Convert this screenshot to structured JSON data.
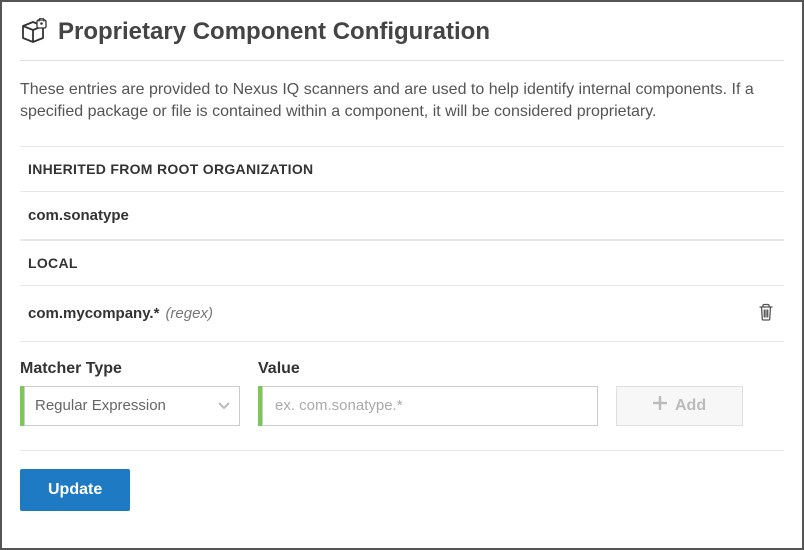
{
  "header": {
    "title": "Proprietary Component Configuration"
  },
  "description": "These entries are provided to Nexus IQ scanners and are used to help identify internal components. If a specified package or file is contained within a component, it will be considered proprietary.",
  "sections": {
    "inherited": {
      "label": "INHERITED FROM ROOT ORGANIZATION",
      "entries": [
        {
          "value": "com.sonatype",
          "regex_suffix": ""
        }
      ]
    },
    "local": {
      "label": "LOCAL",
      "entries": [
        {
          "value": "com.mycompany.*",
          "regex_suffix": "(regex)"
        }
      ]
    }
  },
  "form": {
    "matcher_label": "Matcher Type",
    "matcher_value": "Regular Expression",
    "value_label": "Value",
    "value_placeholder": "ex. com.sonatype.*",
    "value_current": "",
    "add_label": "Add"
  },
  "footer": {
    "update_label": "Update"
  },
  "colors": {
    "accent_green": "#7dc855",
    "primary_blue": "#1f7ac4"
  }
}
